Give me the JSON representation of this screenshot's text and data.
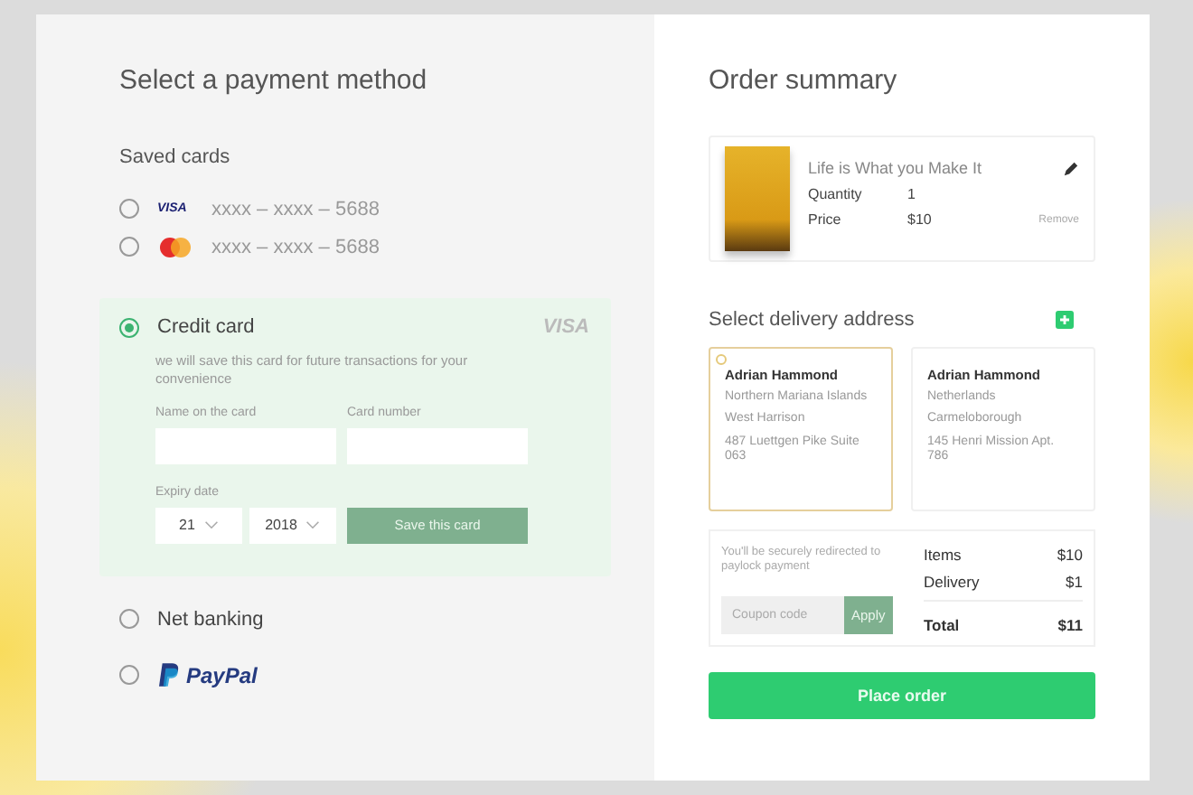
{
  "payment": {
    "title": "Select a payment method",
    "saved_title": "Saved cards",
    "saved_cards": [
      {
        "kind": "visa",
        "brand_text": "VISA",
        "number": "xxxx – xxxx – 5688",
        "selected": false
      },
      {
        "kind": "mastercard",
        "number": "xxxx – xxxx – 5688",
        "selected": false
      }
    ],
    "methods": [
      {
        "kind": "credit_card",
        "label": "Credit card",
        "selected": true,
        "brand_text": "VISA",
        "note": "we will save this card for future transactions for your convenience",
        "name_label": "Name on the card",
        "number_label": "Card number",
        "expiry_label": "Expiry date",
        "month": "21",
        "year": "2018",
        "save_button": "Save this card"
      },
      {
        "kind": "net_banking",
        "label": "Net banking",
        "selected": false
      },
      {
        "kind": "paypal",
        "label": "PayPal",
        "selected": false
      }
    ]
  },
  "summary": {
    "title": "Order summary",
    "product": {
      "title": "Life is What you Make It",
      "quantity_label": "Quantity",
      "quantity": "1",
      "price_label": "Price",
      "price": "$10",
      "remove": "Remove"
    },
    "delivery_title": "Select delivery address",
    "addresses": [
      {
        "name": "Adrian Hammond",
        "lines": [
          "Northern Mariana Islands",
          "West Harrison",
          "487 Luettgen Pike Suite 063"
        ],
        "selected": true
      },
      {
        "name": "Adrian Hammond",
        "lines": [
          "Netherlands",
          "Carmeloborough",
          "145 Henri Mission Apt. 786"
        ],
        "selected": false
      }
    ],
    "redirect_note": "You'll be securely redirected to paylock payment",
    "coupon_placeholder": "Coupon code",
    "apply": "Apply",
    "totals": [
      {
        "kind": "line",
        "label": "Items",
        "value": "$10"
      },
      {
        "kind": "line",
        "label": "Delivery",
        "value": "$1"
      },
      {
        "kind": "total",
        "label": "Total",
        "value": "$11"
      }
    ],
    "place_order": "Place order"
  }
}
